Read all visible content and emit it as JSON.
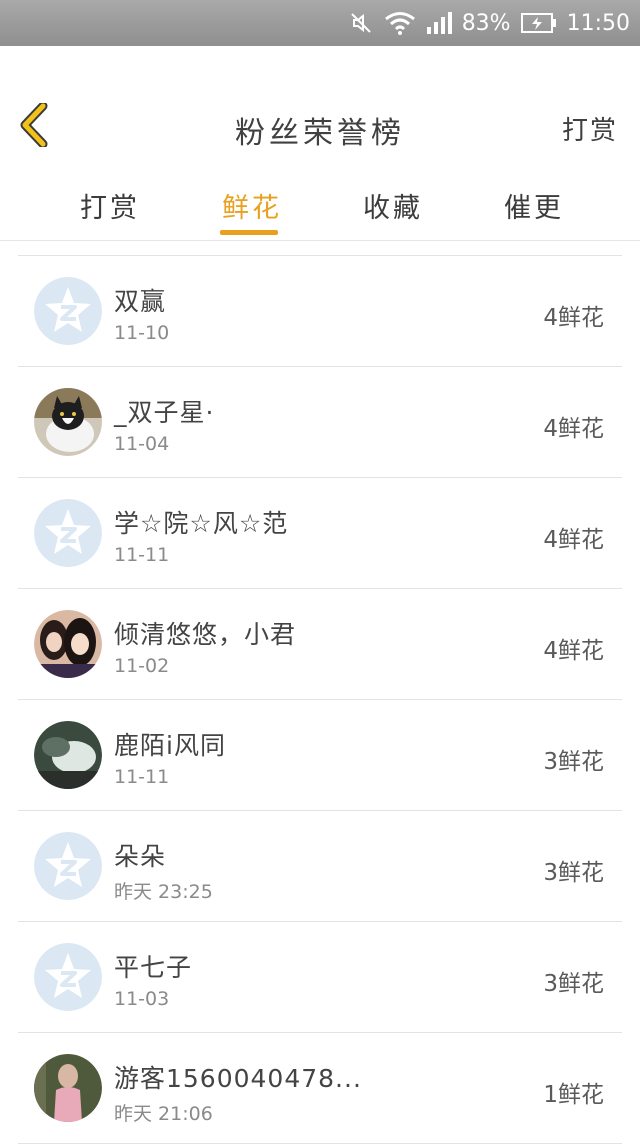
{
  "status_bar": {
    "battery": "83%",
    "time": "11:50",
    "icons": [
      "mute-icon",
      "wifi-icon",
      "signal-icon",
      "battery-charging-icon"
    ]
  },
  "header": {
    "title": "粉丝荣誉榜",
    "right_action": "打赏",
    "back_icon": "chevron-left-icon",
    "accent_color": "#e8a01e"
  },
  "tabs": [
    {
      "label": "打赏"
    },
    {
      "label": "鲜花",
      "active": true
    },
    {
      "label": "收藏"
    },
    {
      "label": "催更"
    }
  ],
  "list": [
    {
      "name": "双赢",
      "date": "11-10",
      "amount": "4鲜花",
      "avatar": "default-qq-avatar"
    },
    {
      "name": "_双子星·",
      "date": "11-04",
      "amount": "4鲜花",
      "avatar": "cat-photo-avatar"
    },
    {
      "name": "学☆院☆风☆范",
      "date": "11-11",
      "amount": "4鲜花",
      "avatar": "default-qq-avatar"
    },
    {
      "name": "倾清悠悠，小君",
      "date": "11-02",
      "amount": "4鲜花",
      "avatar": "two-girls-photo-avatar"
    },
    {
      "name": "鹿陌i风同",
      "date": "11-11",
      "amount": "3鲜花",
      "avatar": "blurred-photo-avatar"
    },
    {
      "name": "朵朵",
      "date": "昨天 23:25",
      "amount": "3鲜花",
      "avatar": "default-qq-avatar"
    },
    {
      "name": "平七子",
      "date": "11-03",
      "amount": "3鲜花",
      "avatar": "default-qq-avatar"
    },
    {
      "name": "游客1560040478...",
      "date": "昨天 21:06",
      "amount": "1鲜花",
      "avatar": "person-photo-avatar"
    }
  ]
}
